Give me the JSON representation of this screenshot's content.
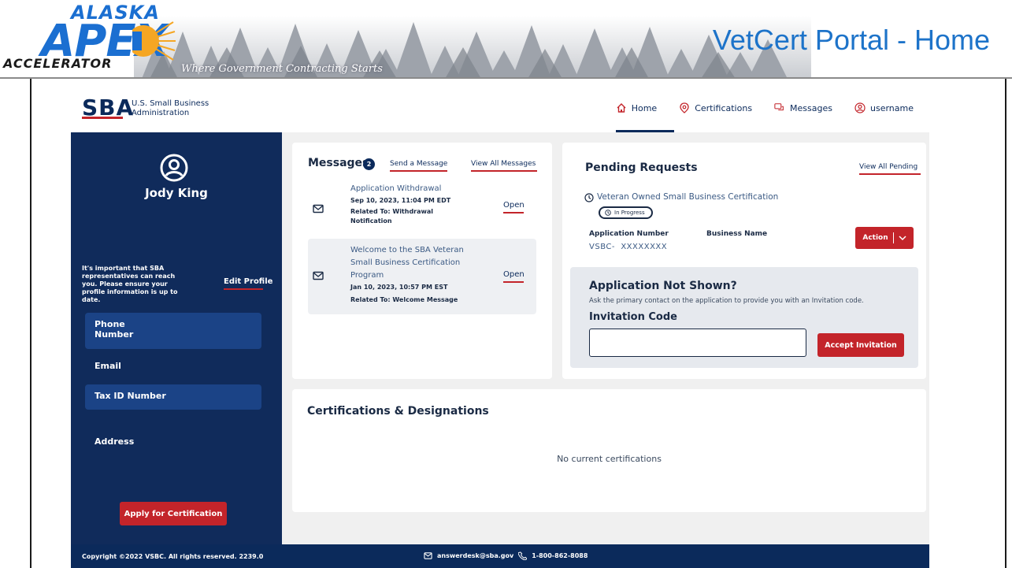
{
  "banner": {
    "logo_top": "ALASKA",
    "logo_main": "APEX",
    "logo_bottom": "ACCELERATOR",
    "tagline": "Where Government Contracting Starts",
    "slide_title": "VetCert Portal - Home"
  },
  "header": {
    "agency_logo": "SBA",
    "agency_name_line1": "U.S. Small Business",
    "agency_name_line2": "Administration",
    "nav": [
      {
        "label": "Home",
        "icon": "home-icon"
      },
      {
        "label": "Certifications",
        "icon": "certificate-icon"
      },
      {
        "label": "Messages",
        "icon": "chat-icon"
      },
      {
        "label": "username",
        "icon": "user-circle-icon"
      }
    ]
  },
  "sidebar": {
    "user_name": "Jody King",
    "reach_text": "It's important that SBA representatives can reach you. Please ensure your profile information is up to date.",
    "edit_profile": "Edit Profile",
    "fields": [
      {
        "label": "Phone\nNumber"
      },
      {
        "label": "Email"
      },
      {
        "label": "Tax ID Number"
      },
      {
        "label": "Address"
      }
    ],
    "apply_button": "Apply for Certification"
  },
  "messages": {
    "title": "Messages",
    "count": "2",
    "send_link": "Send a Message",
    "view_all_link": "View All Messages",
    "items": [
      {
        "title": "Application Withdrawal",
        "date": "Sep 10, 2023, 11:04 PM EDT",
        "related_line1": "Related To: Withdrawal",
        "related_line2": "Notification",
        "open": "Open"
      },
      {
        "title_line1": "Welcome to the SBA Veteran",
        "title_line2": "Small Business Certification",
        "title_line3": "Program",
        "date": "Jan 10, 2023, 10:57 PM EST",
        "related": "Related To: Welcome Message",
        "open": "Open"
      }
    ]
  },
  "pending": {
    "title": "Pending Requests",
    "view_all_link": "View All Pending",
    "request_name": "Veteran Owned Small Business Certification",
    "status": "In Progress",
    "app_number_label": "Application Number",
    "app_number_value": "VSBC-  XXXXXXXX",
    "business_name_label": "Business Name",
    "action_button": "Action",
    "not_shown_title": "Application Not Shown?",
    "not_shown_desc": "Ask the primary contact on the application to provide you with an Invitation code.",
    "invitation_label": "Invitation Code",
    "invitation_value": "",
    "accept_button": "Accept Invitation"
  },
  "certifications": {
    "title": "Certifications & Designations",
    "empty_text": "No current certifications"
  },
  "footer": {
    "copyright": "Copyright ©2022 VSBC. All rights reserved. 2239.0",
    "email": "answerdesk@sba.gov",
    "phone": "1-800-862-8088"
  },
  "colors": {
    "navy": "#0b2a5b",
    "sidebar": "#102b5b",
    "accent_red": "#c3242a",
    "title_blue": "#1d73c9"
  }
}
